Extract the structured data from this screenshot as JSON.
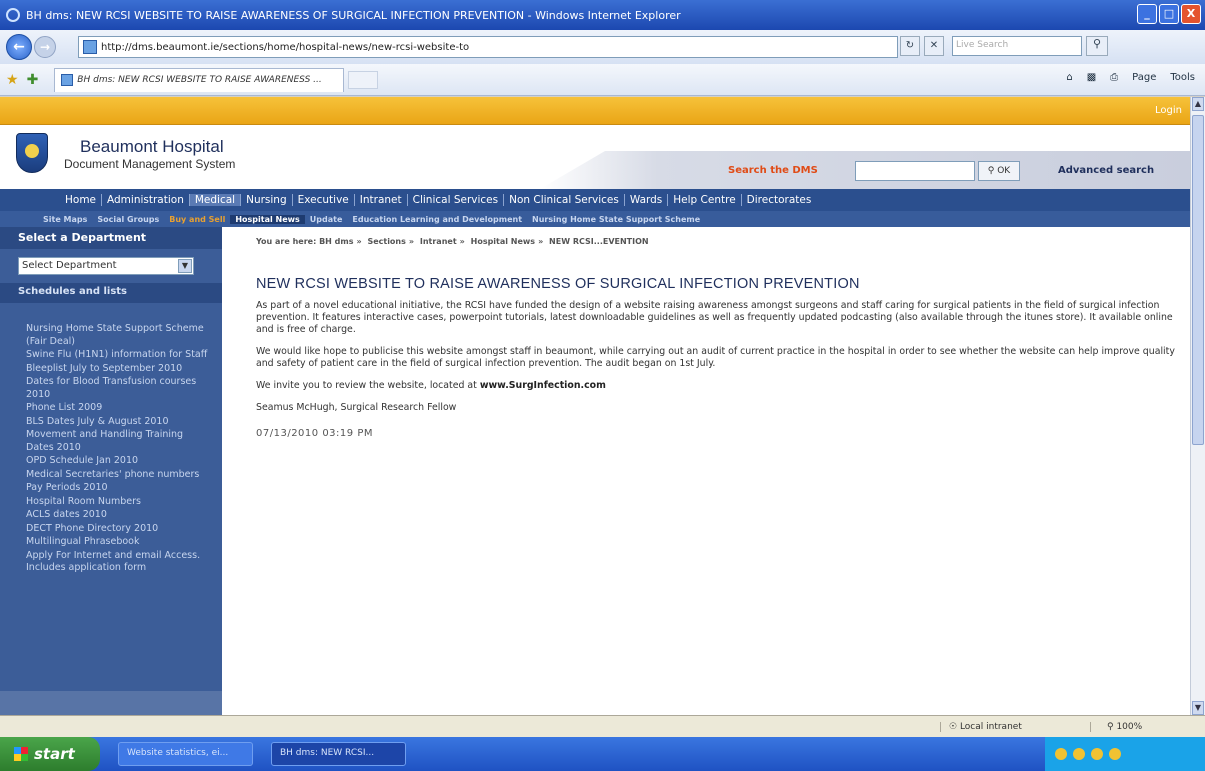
{
  "window": {
    "title": "BH dms: NEW RCSI WEBSITE TO RAISE AWARENESS OF SURGICAL INFECTION PREVENTION - Windows Internet Explorer",
    "minimize": "_",
    "maximize": "□",
    "close": "X"
  },
  "browser": {
    "url": "http://dms.beaumont.ie/sections/home/hospital-news/new-rcsi-website-to",
    "search_placeholder": "Live Search",
    "tab_title": "BH dms: NEW RCSI WEBSITE TO RAISE AWARENESS ...",
    "page_menu": "Page",
    "tools_menu": "Tools",
    "status_zone": "Local intranet",
    "zoom": "100%"
  },
  "site": {
    "login": "Login",
    "title": "Beaumont Hospital",
    "subtitle": "Document Management System",
    "search_label": "Search the DMS",
    "ok_label": "OK",
    "advanced_search": "Advanced search",
    "main_nav": [
      "Home",
      "Administration",
      "Medical",
      "Nursing",
      "Executive",
      "Intranet",
      "Clinical Services",
      "Non Clinical Services",
      "Wards",
      "Help Centre",
      "Directorates"
    ],
    "sub_nav": [
      "Site Maps",
      "Social Groups",
      "Buy and Sell",
      "Hospital News",
      "Update",
      "Education Learning and Development",
      "Nursing Home State Support Scheme"
    ]
  },
  "sidebar": {
    "select_header": "Select a Department",
    "select_value": "Select Department",
    "schedules_header": "Schedules and lists",
    "items": [
      "Nursing Home State Support Scheme (Fair Deal)",
      "Swine Flu (H1N1) information for Staff",
      "Bleeplist July to September 2010",
      "Dates for Blood Transfusion courses 2010",
      "Phone List 2009",
      "BLS Dates July & August 2010",
      "Movement and Handling Training Dates 2010",
      "OPD Schedule Jan 2010",
      "Medical Secretaries' phone numbers",
      "Pay Periods 2010",
      "Hospital Room Numbers",
      "ACLS dates 2010",
      "DECT Phone Directory 2010",
      "Multilingual Phrasebook",
      "Apply For Internet and email Access. Includes application form"
    ]
  },
  "article": {
    "breadcrumb": [
      "You are here: BH dms",
      "Sections",
      "Intranet",
      "Hospital News",
      "NEW RCSI...EVENTION"
    ],
    "headline": "NEW RCSI WEBSITE TO RAISE AWARENESS OF SURGICAL INFECTION PREVENTION",
    "para1": "As part of a novel educational initiative, the RCSI have funded the design of a website raising awareness amongst surgeons and staff caring for surgical patients in the field of surgical infection prevention. It features interactive cases, powerpoint tutorials, latest downloadable guidelines as well as frequently updated podcasting (also available through the itunes store). It available online and is free of charge.",
    "para2": "We would like hope to publicise this website amongst staff in beaumont, while carrying out an audit of current practice in the hospital in order to see whether the website can help improve quality and safety of patient care in the field of surgical infection prevention. The audit began on 1st July.",
    "para3_prefix": "We invite you to review the website, located at ",
    "para3_url": "www.SurgInfection.com",
    "author": "Seamus McHugh, Surgical Research Fellow",
    "date": "07/13/2010 03:19 PM"
  },
  "taskbar": {
    "start": "start",
    "tasks": [
      "Website statistics, ei...",
      "BH dms: NEW RCSI..."
    ]
  }
}
